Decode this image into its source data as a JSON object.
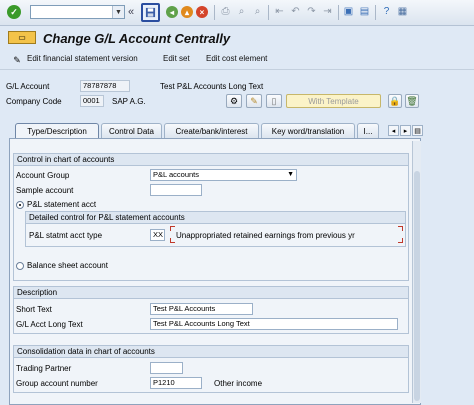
{
  "toolbar": {
    "command_field": "",
    "icons": [
      "check-icon",
      "save-icon",
      "back-icon",
      "exit-icon",
      "cancel-icon",
      "print-icon",
      "find-icon",
      "find-next-icon",
      "first-page-icon",
      "previous-page-icon",
      "next-page-icon",
      "last-page-icon",
      "new-session-icon",
      "shortcut-icon",
      "help-icon"
    ],
    "colors": {
      "check": "#3a9a2a",
      "back": "#5fa14a",
      "exit": "#e08a1e",
      "cancel": "#d4442a",
      "save_border": "#2b4ea0"
    }
  },
  "title": "Change G/L Account Centrally",
  "appbar": {
    "buttons": [
      "Edit financial statement version",
      "Edit set",
      "Edit cost element"
    ]
  },
  "header": {
    "gl_account_label": "G/L Account",
    "gl_account_value": "78787878",
    "gl_account_text": "Test P&L Accounts Long Text",
    "company_code_label": "Company Code",
    "company_code_value": "0001",
    "company_code_text": "SAP A.G.",
    "template_button": "With Template"
  },
  "tabs": [
    "Type/Description",
    "Control Data",
    "Create/bank/interest",
    "Key word/translation",
    "I..."
  ],
  "control_group": {
    "title": "Control in chart of accounts",
    "account_group_label": "Account Group",
    "account_group_value": "P&L accounts",
    "sample_account_label": "Sample account",
    "sample_account_value": "",
    "pl_radio_label": "P&L statement acct",
    "detail_title": "Detailed control for P&L statement accounts",
    "pl_type_label": "P&L statmt acct type",
    "pl_type_value": "XX",
    "pl_type_text": "Unappropriated retained earnings from previous yr",
    "bs_radio_label": "Balance sheet account"
  },
  "description_group": {
    "title": "Description",
    "short_text_label": "Short Text",
    "short_text_value": "Test P&L Accounts",
    "long_text_label": "G/L Acct Long Text",
    "long_text_value": "Test P&L Accounts Long Text"
  },
  "consolidation_group": {
    "title": "Consolidation data in chart of accounts",
    "trading_partner_label": "Trading Partner",
    "trading_partner_value": "",
    "group_account_label": "Group account number",
    "group_account_value": "P1210",
    "group_account_text": "Other income"
  }
}
